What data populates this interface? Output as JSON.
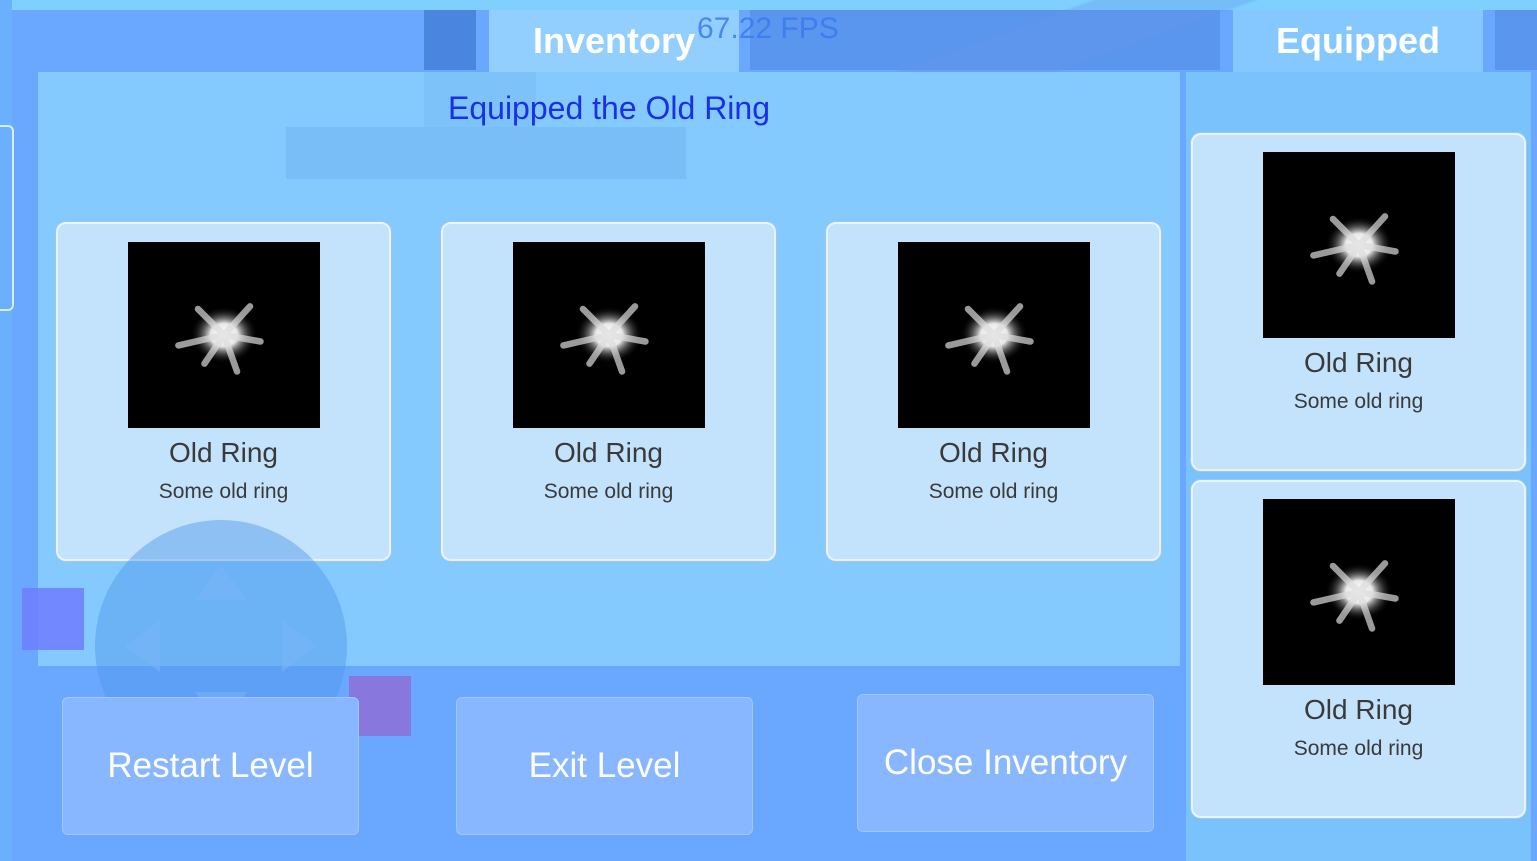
{
  "tabs": {
    "inventory_label": "Inventory",
    "equipped_label": "Equipped"
  },
  "fps_text": "67.22 FPS",
  "status_message": "Equipped the Old Ring",
  "inventory_items": [
    {
      "name": "Old Ring",
      "description": "Some old ring",
      "icon": "ring-glow-icon"
    },
    {
      "name": "Old Ring",
      "description": "Some old ring",
      "icon": "ring-glow-icon"
    },
    {
      "name": "Old Ring",
      "description": "Some old ring",
      "icon": "ring-glow-icon"
    }
  ],
  "equipped_items": [
    {
      "name": "Old Ring",
      "description": "Some old ring",
      "icon": "ring-glow-icon"
    },
    {
      "name": "Old Ring",
      "description": "Some old ring",
      "icon": "ring-glow-icon"
    }
  ],
  "buttons": {
    "restart": "Restart Level",
    "exit": "Exit Level",
    "close_inventory": "Close Inventory"
  },
  "colors": {
    "status_text": "#1a2fe8",
    "panel": "#84caff",
    "card": "#c3e2fb",
    "button": "#88b7ff"
  }
}
